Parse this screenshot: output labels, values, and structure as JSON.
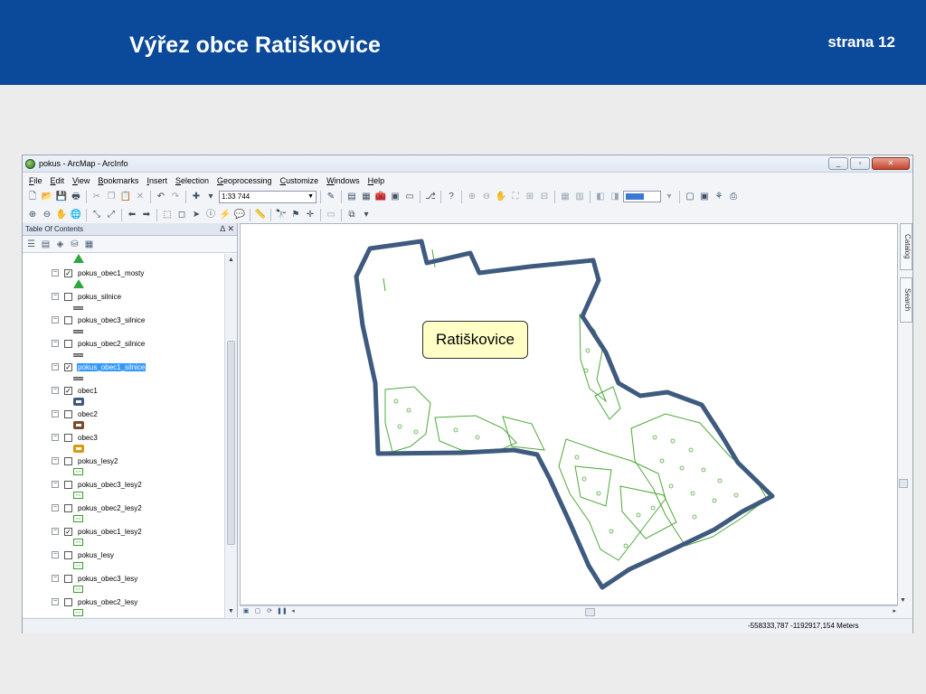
{
  "slide": {
    "title": "Výřez obce Ratiškovice",
    "page": "strana 12",
    "header_color": "#0b4a9a"
  },
  "app": {
    "title": "pokus - ArcMap - ArcInfo",
    "window_buttons": [
      "minimize",
      "maximize",
      "close"
    ],
    "menu": [
      "File",
      "Edit",
      "View",
      "Bookmarks",
      "Insert",
      "Selection",
      "Geoprocessing",
      "Customize",
      "Windows",
      "Help"
    ],
    "scale": "1:33 744"
  },
  "toc": {
    "title": "Table Of Contents",
    "pin": "∆ ✕",
    "layers": [
      {
        "name": "pokus_obec1_mosty",
        "checked": true,
        "symbol": "triangle-green"
      },
      {
        "name": "pokus_silnice",
        "checked": false,
        "symbol": "line-grey"
      },
      {
        "name": "pokus_obec3_silnice",
        "checked": false,
        "symbol": "line-grey"
      },
      {
        "name": "pokus_obec2_silnice",
        "checked": false,
        "symbol": "line-grey"
      },
      {
        "name": "pokus_obec1_silnice",
        "checked": true,
        "symbol": "line-grey",
        "selected": true
      },
      {
        "name": "obec1",
        "checked": true,
        "symbol": "polygon",
        "color": "#3e5a7e"
      },
      {
        "name": "obec2",
        "checked": false,
        "symbol": "polygon",
        "color": "#7a4a2c"
      },
      {
        "name": "obec3",
        "checked": false,
        "symbol": "polygon",
        "color": "#d89a12"
      },
      {
        "name": "pokus_lesy2",
        "checked": false,
        "symbol": "forest"
      },
      {
        "name": "pokus_obec3_lesy2",
        "checked": false,
        "symbol": "forest"
      },
      {
        "name": "pokus_obec2_lesy2",
        "checked": false,
        "symbol": "forest"
      },
      {
        "name": "pokus_obec1_lesy2",
        "checked": true,
        "symbol": "forest"
      },
      {
        "name": "pokus_lesy",
        "checked": false,
        "symbol": "forest"
      },
      {
        "name": "pokus_obec3_lesy",
        "checked": false,
        "symbol": "forest"
      },
      {
        "name": "pokus_obec2_lesy",
        "checked": false,
        "symbol": "forest"
      }
    ]
  },
  "map": {
    "label": "Ratiškovice",
    "boundary_color": "#3e5a7e",
    "forest_color": "#4fa83a"
  },
  "sidebar": {
    "catalog": "Catalog",
    "search": "Search"
  },
  "status": {
    "coordinates": "-558333,787  -1192917,154 Meters"
  }
}
